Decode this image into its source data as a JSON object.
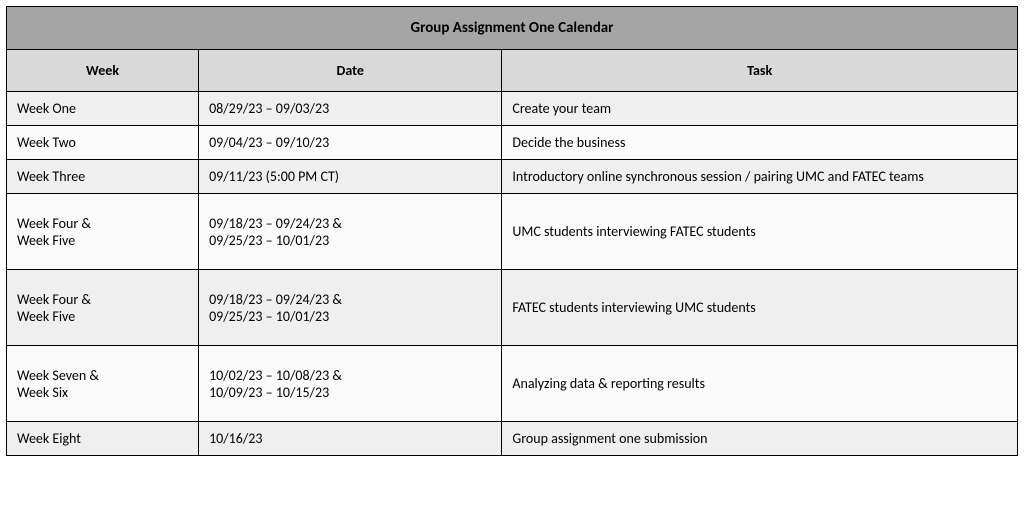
{
  "title": "Group Assignment One Calendar",
  "columns": [
    "Week",
    "Date",
    "Task"
  ],
  "rows": [
    {
      "week": "Week One",
      "date": "08/29/23 – 09/03/23",
      "task": "Create your team",
      "shade": "odd",
      "tall": false
    },
    {
      "week": "Week Two",
      "date": "09/04/23 – 09/10/23",
      "task": "Decide the business",
      "shade": "even",
      "tall": false
    },
    {
      "week": "Week Three",
      "date": "09/11/23 (5:00 PM CT)",
      "task": "Introductory online synchronous session / pairing UMC and FATEC teams",
      "shade": "odd",
      "tall": false
    },
    {
      "week": "Week Four &\nWeek Five",
      "date": "09/18/23 – 09/24/23 &\n09/25/23 – 10/01/23",
      "task": "UMC students interviewing FATEC students",
      "shade": "even",
      "tall": true
    },
    {
      "week": "Week Four &\nWeek Five",
      "date": "09/18/23 – 09/24/23 &\n09/25/23 – 10/01/23",
      "task": "FATEC students interviewing UMC students",
      "shade": "odd",
      "tall": true
    },
    {
      "week": "Week Seven &\nWeek Six",
      "date": "10/02/23 – 10/08/23 &\n10/09/23 – 10/15/23",
      "task": "Analyzing data & reporting results",
      "shade": "even",
      "tall": true
    },
    {
      "week": "Week Eight",
      "date": "10/16/23",
      "task": "Group assignment one submission",
      "shade": "odd",
      "tall": false
    }
  ]
}
